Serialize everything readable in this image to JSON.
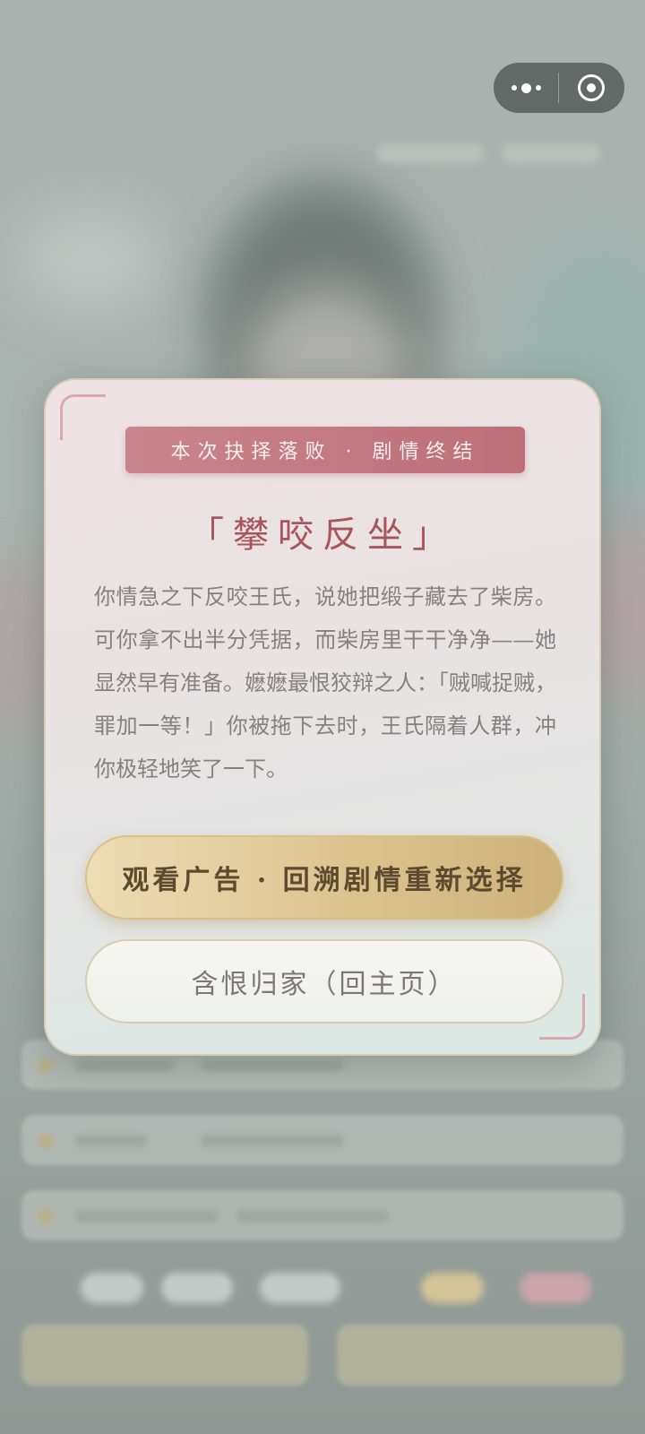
{
  "capsule": {
    "more_icon": "more-dots-icon",
    "close_icon": "target-close-icon"
  },
  "modal": {
    "banner": "本次抉择落败 · 剧情终结",
    "title": "「攀咬反坐」",
    "body": "你情急之下反咬王氏，说她把缎子藏去了柴房。可你拿不出半分凭据，而柴房里干干净净——她显然早有准备。嬷嬷最恨狡辩之人：「贼喊捉贼，罪加一等！」你被拖下去时，王氏隔着人群，冲你极轻地笑了一下。",
    "primary_button": "观看广告 · 回溯剧情重新选择",
    "secondary_button": "含恨归家（回主页）"
  },
  "colors": {
    "banner": "#bd6f78",
    "title": "#a8555f",
    "primary_button": "#dcc48f",
    "corner_accent": "#d9a8ad"
  }
}
